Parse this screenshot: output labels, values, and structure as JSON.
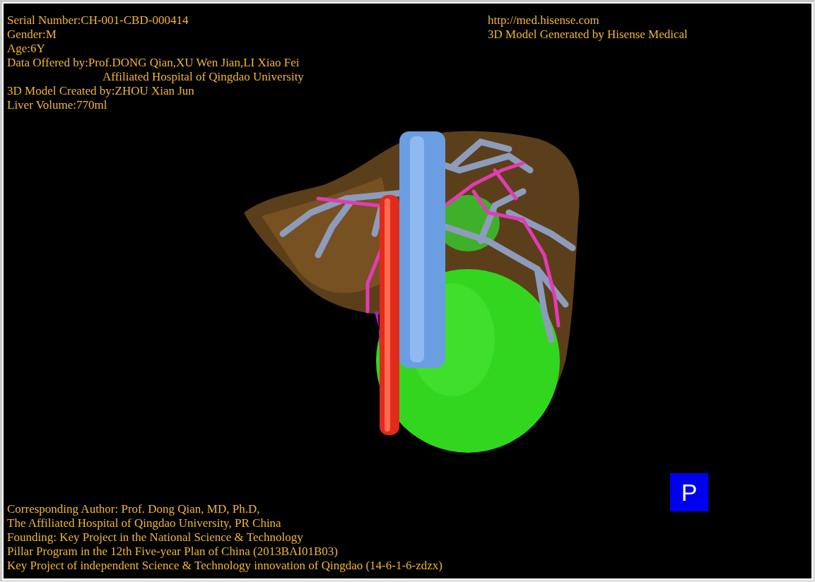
{
  "patient_info": [
    {
      "text": "Serial Number:CH-001-CBD-000414"
    },
    {
      "text": "Gender:M"
    },
    {
      "text": "Age:6Y"
    },
    {
      "text": "Data Offered by:Prof.DONG Qian,XU Wen Jian,LI Xiao Fei",
      "continuation": "Affiliated Hospital of Qingdao University"
    },
    {
      "text": "3D Model Created by:ZHOU Xian Jun"
    },
    {
      "text": "Liver Volume:770ml"
    }
  ],
  "generator_info": [
    "http://med.hisense.com",
    "3D Model Generated by Hisense Medical"
  ],
  "credits": [
    "Corresponding Author: Prof. Dong Qian, MD, Ph.D,",
    "The Affiliated Hospital of Qingdao University, PR China",
    "Founding: Key Project in the National Science & Technology",
    "Pillar Program in the 12th Five-year Plan of China (2013BAI01B03)",
    "Key Project of independent Science & Technology innovation of Qingdao (14-6-1-6-zdzx)"
  ],
  "view_button": {
    "label": "P"
  }
}
